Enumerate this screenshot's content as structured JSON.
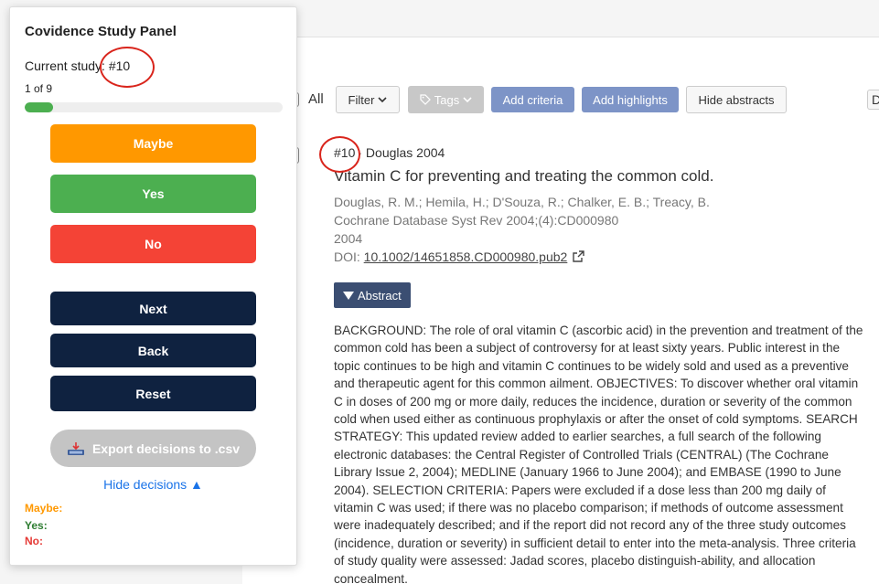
{
  "toolbar": {
    "all_label": "All",
    "filter_label": "Filter",
    "tags_label": "Tags",
    "add_criteria_label": "Add criteria",
    "add_highlights_label": "Add highlights",
    "hide_abstracts_label": "Hide abstracts",
    "cut_label": "D"
  },
  "study": {
    "id": "#10",
    "author_year": "Douglas 2004",
    "title": "Vitamin C for preventing and treating the common cold.",
    "authors": "Douglas, R. M.; Hemila, H.; D'Souza, R.; Chalker, E. B.; Treacy, B.",
    "journal": "Cochrane Database Syst Rev 2004;(4):CD000980",
    "year": "2004",
    "doi_label": "DOI:",
    "doi": "10.1002/14651858.CD000980.pub2",
    "abstract_button": "Abstract",
    "abstract": "BACKGROUND: The role of oral vitamin C (ascorbic acid) in the prevention and treatment of the common cold has been a subject of controversy for at least sixty years. Public interest in the topic continues to be high and vitamin C continues to be widely sold and used as a preventive and therapeutic agent for this common ailment. OBJECTIVES: To discover whether oral vitamin C in doses of 200 mg or more daily, reduces the incidence, duration or severity of the common cold when used either as continuous prophylaxis or after the onset of cold symptoms. SEARCH STRATEGY: This updated review added to earlier searches, a full search of the following electronic databases: the Central Register of Controlled Trials (CENTRAL) (The Cochrane Library Issue 2, 2004); MEDLINE (January 1966 to June 2004); and EMBASE (1990 to June 2004). SELECTION CRITERIA: Papers were excluded if a dose less than 200 mg daily of vitamin C was used; if there was no placebo comparison; if methods of outcome assessment were inadequately described; and if the report did not record any of the three study outcomes (incidence, duration or severity) in sufficient detail to enter into the meta-analysis. Three criteria of study quality were assessed: Jadad scores, placebo distinguish-ability, and allocation concealment."
  },
  "panel": {
    "title": "Covidence Study Panel",
    "current_study_label": "Current study: #10",
    "count": "1 of 9",
    "progress": 0.111,
    "maybe_label": "Maybe",
    "yes_label": "Yes",
    "no_label": "No",
    "next_label": "Next",
    "back_label": "Back",
    "reset_label": "Reset",
    "export_label": "Export decisions to .csv",
    "hide_decisions_label": "Hide decisions ▲",
    "decision_maybe": "Maybe:",
    "decision_yes": "Yes:",
    "decision_no": "No:"
  },
  "colors": {
    "maybe": "#ff9800",
    "yes": "#4caf50",
    "no": "#f44336",
    "nav": "#0f2240",
    "accent": "#7d94c7",
    "annotation": "#d9251c"
  }
}
